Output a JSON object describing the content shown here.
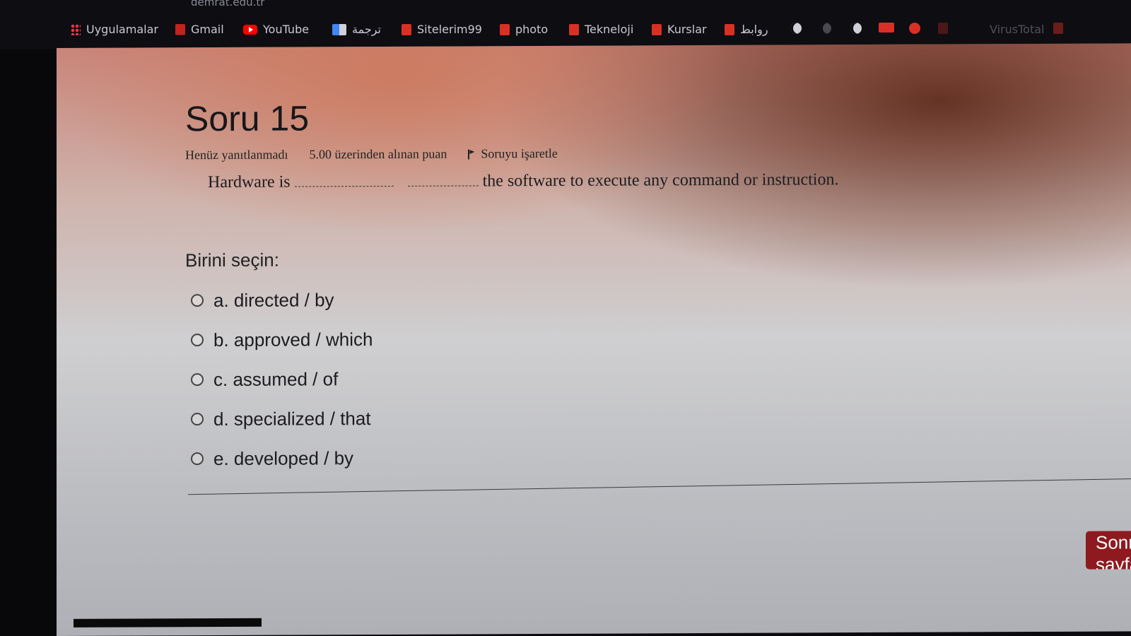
{
  "browser": {
    "address_fragment": "demrat.edu.tr",
    "bookmarks": [
      {
        "label": "Uygulamalar",
        "icon": "apps-grid-icon"
      },
      {
        "label": "Gmail",
        "icon": "gmail-icon"
      },
      {
        "label": "YouTube",
        "icon": "youtube-icon"
      },
      {
        "label": "ترجمة",
        "icon": "translate-icon"
      },
      {
        "label": "Sitelerim99",
        "icon": "bookmark-folder-icon"
      },
      {
        "label": "photo",
        "icon": "bookmark-folder-icon"
      },
      {
        "label": "Tekneloji",
        "icon": "bookmark-folder-icon"
      },
      {
        "label": "Kurslar",
        "icon": "bookmark-folder-icon"
      },
      {
        "label": "روابط",
        "icon": "bookmark-folder-icon"
      },
      {
        "label": "VirusTotal",
        "icon": "virustotal-icon"
      }
    ]
  },
  "question": {
    "title": "Soru 15",
    "status": "Henüz yanıtlanmadı",
    "points": "5.00 üzerinden alınan puan",
    "flag_label": "Soruyu işaretle",
    "text_before": "Hardware is",
    "text_after": "the software to execute any command or instruction.",
    "prompt": "Birini seçin:",
    "options": [
      "a. directed / by",
      "b. approved / which",
      "c. assumed / of",
      "d. specialized / that",
      "e. developed / by"
    ]
  },
  "navigation": {
    "next_label": "Sonraki sayfa"
  },
  "colors": {
    "next_button": "#8e1a1f",
    "page_tint": "#c9857a"
  }
}
